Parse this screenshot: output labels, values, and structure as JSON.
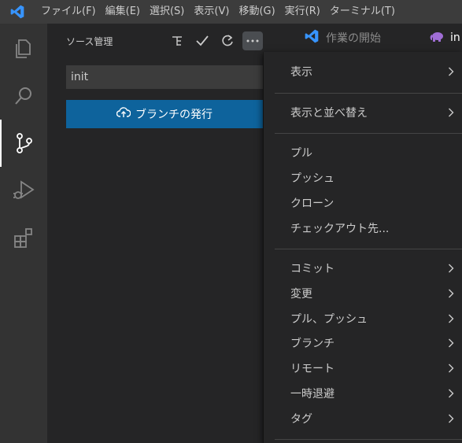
{
  "menubar": {
    "items": [
      "ファイル(F)",
      "編集(E)",
      "選択(S)",
      "表示(V)",
      "移動(G)",
      "実行(R)",
      "ターミナル(T)"
    ]
  },
  "activitybar": {
    "items": [
      "explorer-icon",
      "search-icon",
      "source-control-icon",
      "run-debug-icon",
      "extensions-icon"
    ],
    "active": "source-control-icon"
  },
  "sidebar": {
    "title": "ソース管理",
    "commit_input_value": "init",
    "publish_button_label": "ブランチの発行"
  },
  "tabs": [
    {
      "label": "作業の開始",
      "icon": "vscode-logo-icon"
    },
    {
      "label": "in",
      "icon": "php-elephant-icon"
    }
  ],
  "context_menu": {
    "groups": [
      [
        {
          "label": "表示",
          "submenu": true
        }
      ],
      [
        {
          "label": "表示と並べ替え",
          "submenu": true
        }
      ],
      [
        {
          "label": "プル",
          "submenu": false
        },
        {
          "label": "プッシュ",
          "submenu": false
        },
        {
          "label": "クローン",
          "submenu": false
        },
        {
          "label": "チェックアウト先...",
          "submenu": false
        }
      ],
      [
        {
          "label": "コミット",
          "submenu": true
        },
        {
          "label": "変更",
          "submenu": true
        },
        {
          "label": "プル、プッシュ",
          "submenu": true
        },
        {
          "label": "ブランチ",
          "submenu": true
        },
        {
          "label": "リモート",
          "submenu": true
        },
        {
          "label": "一時退避",
          "submenu": true
        },
        {
          "label": "タグ",
          "submenu": true
        }
      ]
    ]
  },
  "colors": {
    "accent": "#0e639c",
    "vscode_blue": "#3794ff",
    "titlebar": "#3c3c3c",
    "activitybar": "#333333",
    "sidebar": "#252526"
  }
}
